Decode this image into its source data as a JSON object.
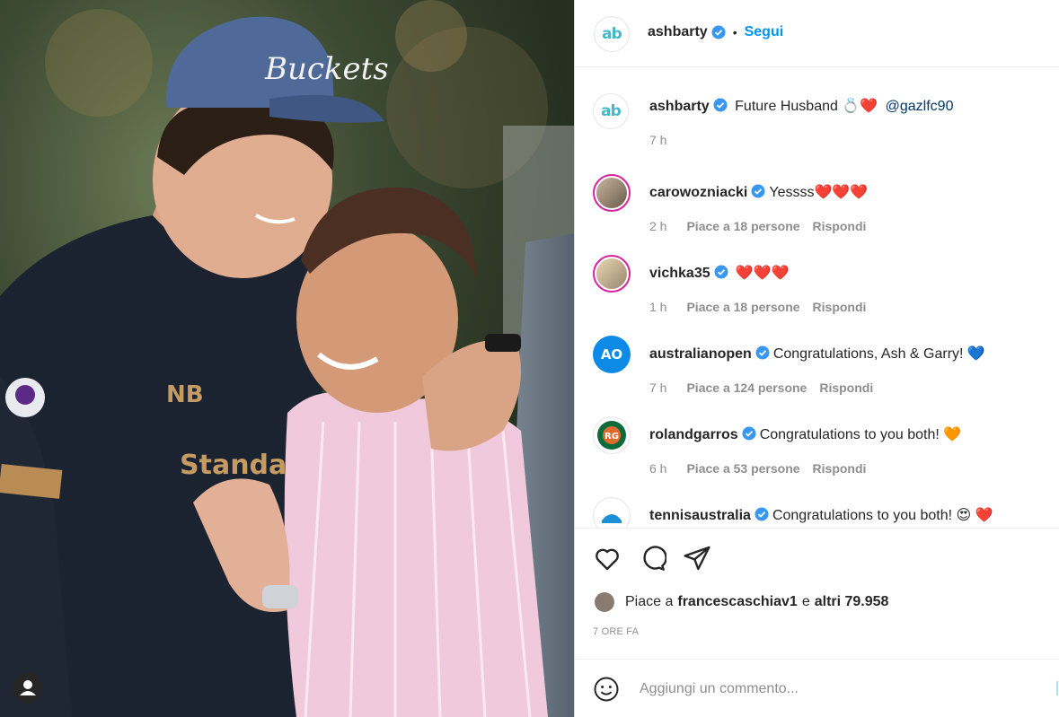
{
  "header": {
    "username": "ashbarty",
    "separator": "•",
    "follow_label": "Segui"
  },
  "caption": {
    "username": "ashbarty",
    "text": "Future Husband",
    "emoji": "💍❤️",
    "mention": "@gazlfc90",
    "time": "7 h"
  },
  "comments": [
    {
      "username": "carowozniacki",
      "text": "Yessss❤️❤️❤️",
      "time": "2 h",
      "likes": "Piace a 18 persone",
      "reply": "Rispondi"
    },
    {
      "username": "vichka35",
      "text": "❤️❤️❤️",
      "time": "1 h",
      "likes": "Piace a 18 persone",
      "reply": "Rispondi"
    },
    {
      "username": "australianopen",
      "text": "Congratulations, Ash & Garry! 💙",
      "time": "7 h",
      "likes": "Piace a 124 persone",
      "reply": "Rispondi"
    },
    {
      "username": "rolandgarros",
      "text": "Congratulations to you both! 🧡",
      "time": "6 h",
      "likes": "Piace a 53 persone",
      "reply": "Rispondi"
    },
    {
      "username": "tennisaustralia",
      "text": "Congratulations to you both! 😍 ❤️",
      "time": "",
      "likes": "",
      "reply": ""
    }
  ],
  "likes_line": {
    "prefix": "Piace a",
    "user": "francescaschiav1",
    "conj": "e",
    "others": "altri 79.958"
  },
  "time_ago": "7 ORE FA",
  "add_comment": {
    "placeholder": "Aggiungi un commento..."
  },
  "photo_text": {
    "cap_logo": "Buckets",
    "shirt_sponsor": "Standard Chartered"
  },
  "icons": {
    "like": "heart-icon",
    "comment": "comment-icon",
    "share": "paper-plane-icon",
    "emoji": "smiley-icon",
    "verified": "verified-badge-icon",
    "user_tag": "user-tag-icon"
  },
  "colors": {
    "link": "#0095f6",
    "verified": "#3897f0",
    "muted": "#8e8e8e",
    "text": "#262626",
    "ab_logo": "#46b7c8"
  }
}
